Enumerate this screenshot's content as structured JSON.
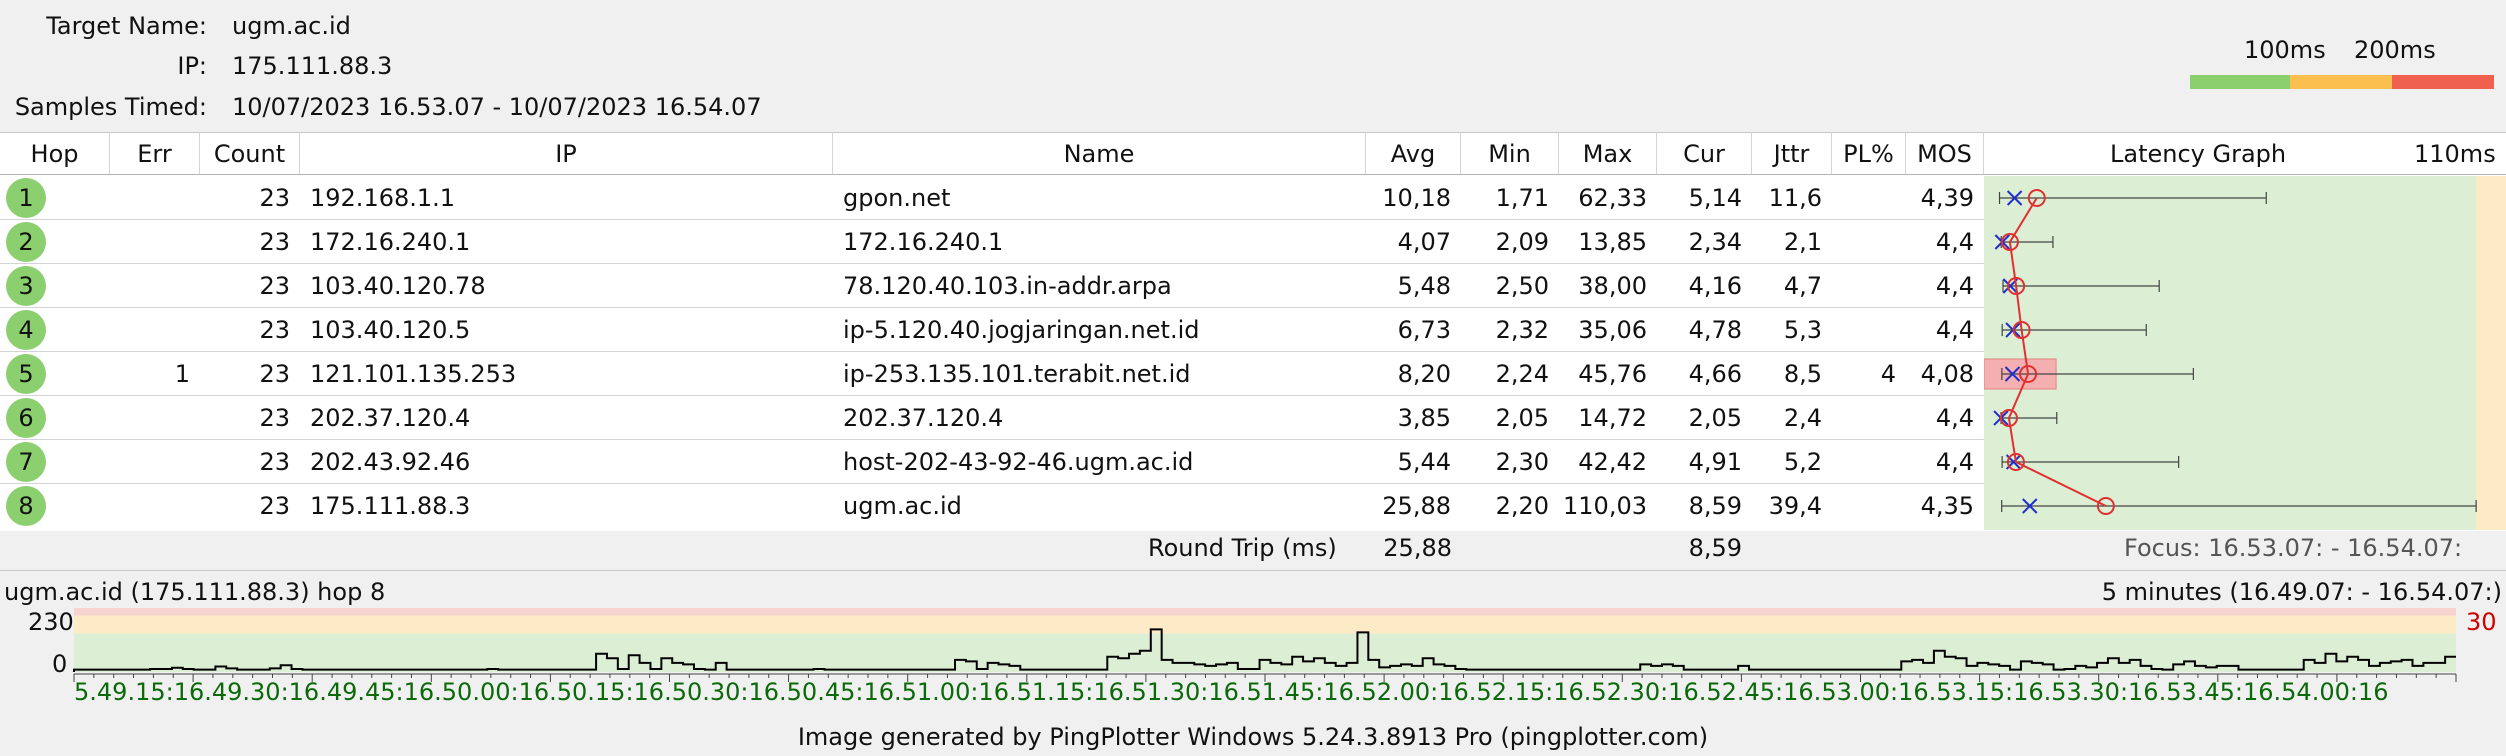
{
  "header": {
    "target_label": "Target Name:",
    "target_value": "ugm.ac.id",
    "ip_label": "IP:",
    "ip_value": "175.111.88.3",
    "samples_label": "Samples Timed:",
    "samples_value": "10/07/2023 16.53.07 - 10/07/2023 16.54.07"
  },
  "legend": {
    "label_100": "100ms",
    "label_200": "200ms",
    "colors": [
      "#8ccf6e",
      "#fbbf4f",
      "#f0604f"
    ]
  },
  "columns": {
    "hop": "Hop",
    "err": "Err",
    "count": "Count",
    "ip": "IP",
    "name": "Name",
    "avg": "Avg",
    "min": "Min",
    "max": "Max",
    "cur": "Cur",
    "jttr": "Jttr",
    "pl": "PL%",
    "mos": "MOS",
    "graph": "Latency Graph",
    "scale": "110ms"
  },
  "rows": [
    {
      "hop": "1",
      "err": "",
      "count": "23",
      "ip": "192.168.1.1",
      "name": "gpon.net",
      "avg": "10,18",
      "min": "1,71",
      "max": "62,33",
      "cur": "5,14",
      "jttr": "11,6",
      "pl": "",
      "mos": "4,39"
    },
    {
      "hop": "2",
      "err": "",
      "count": "23",
      "ip": "172.16.240.1",
      "name": "172.16.240.1",
      "avg": "4,07",
      "min": "2,09",
      "max": "13,85",
      "cur": "2,34",
      "jttr": "2,1",
      "pl": "",
      "mos": "4,4"
    },
    {
      "hop": "3",
      "err": "",
      "count": "23",
      "ip": "103.40.120.78",
      "name": "78.120.40.103.in-addr.arpa",
      "avg": "5,48",
      "min": "2,50",
      "max": "38,00",
      "cur": "4,16",
      "jttr": "4,7",
      "pl": "",
      "mos": "4,4"
    },
    {
      "hop": "4",
      "err": "",
      "count": "23",
      "ip": "103.40.120.5",
      "name": "ip-5.120.40.jogjaringan.net.id",
      "avg": "6,73",
      "min": "2,32",
      "max": "35,06",
      "cur": "4,78",
      "jttr": "5,3",
      "pl": "",
      "mos": "4,4"
    },
    {
      "hop": "5",
      "err": "1",
      "count": "23",
      "ip": "121.101.135.253",
      "name": "ip-253.135.101.terabit.net.id",
      "avg": "8,20",
      "min": "2,24",
      "max": "45,76",
      "cur": "4,66",
      "jttr": "8,5",
      "pl": "4",
      "mos": "4,08"
    },
    {
      "hop": "6",
      "err": "",
      "count": "23",
      "ip": "202.37.120.4",
      "name": "202.37.120.4",
      "avg": "3,85",
      "min": "2,05",
      "max": "14,72",
      "cur": "2,05",
      "jttr": "2,4",
      "pl": "",
      "mos": "4,4"
    },
    {
      "hop": "7",
      "err": "",
      "count": "23",
      "ip": "202.43.92.46",
      "name": "host-202-43-92-46.ugm.ac.id",
      "avg": "5,44",
      "min": "2,30",
      "max": "42,42",
      "cur": "4,91",
      "jttr": "5,2",
      "pl": "",
      "mos": "4,4"
    },
    {
      "hop": "8",
      "err": "",
      "count": "23",
      "ip": "175.111.88.3",
      "name": "ugm.ac.id",
      "avg": "25,88",
      "min": "2,20",
      "max": "110,03",
      "cur": "8,59",
      "jttr": "39,4",
      "pl": "",
      "mos": "4,35"
    }
  ],
  "graph": {
    "scale_max_ms": 110,
    "zone_colors": [
      "#dcefd4",
      "#fdebc8"
    ],
    "lost_row_color": "#f4b0b0"
  },
  "round_trip": {
    "label": "Round Trip (ms)",
    "avg": "25,88",
    "cur": "8,59",
    "focus": "Focus: 16.53.07: - 16.54.07:"
  },
  "timeline": {
    "target": "ugm.ac.id (175.111.88.3) hop 8",
    "range": "5 minutes (16.49.07: - 16.54.07:)",
    "y_top": "230",
    "y_zero": "0",
    "right_value": "30",
    "axis_labels": "5.49.15:16.49.30:16.49.45:16.50.00:16.50.15:16.50.30:16.50.45:16.51.00:16.51.15:16.51.30:16.51.45:16.52.00:16.52.15:16.52.30:16.52.45:16.53.00:16.53.15:16.53.30:16.53.45:16.54.00:16",
    "samples": [
      8,
      8,
      8,
      8,
      8,
      8,
      8,
      10,
      10,
      14,
      10,
      8,
      8,
      18,
      12,
      8,
      8,
      8,
      12,
      22,
      10,
      8,
      8,
      8,
      8,
      8,
      8,
      8,
      8,
      8,
      8,
      8,
      8,
      8,
      8,
      8,
      8,
      8,
      10,
      8,
      8,
      8,
      8,
      8,
      8,
      8,
      8,
      8,
      60,
      45,
      10,
      55,
      30,
      10,
      45,
      30,
      25,
      10,
      8,
      30,
      8,
      8,
      8,
      8,
      8,
      8,
      8,
      8,
      10,
      8,
      8,
      8,
      8,
      8,
      8,
      8,
      8,
      8,
      8,
      8,
      8,
      40,
      35,
      10,
      30,
      25,
      20,
      8,
      8,
      8,
      8,
      8,
      8,
      8,
      8,
      50,
      45,
      60,
      70,
      140,
      40,
      30,
      30,
      25,
      20,
      25,
      30,
      10,
      10,
      40,
      30,
      25,
      50,
      35,
      45,
      30,
      20,
      30,
      130,
      40,
      15,
      20,
      25,
      20,
      45,
      25,
      20,
      10,
      8,
      8,
      8,
      8,
      8,
      8,
      8,
      8,
      8,
      8,
      8,
      8,
      8,
      8,
      8,
      8,
      25,
      20,
      25,
      20,
      8,
      8,
      8,
      8,
      8,
      20,
      8,
      8,
      8,
      8,
      8,
      8,
      8,
      8,
      8,
      8,
      8,
      8,
      8,
      8,
      35,
      40,
      30,
      70,
      50,
      45,
      20,
      30,
      25,
      20,
      8,
      35,
      30,
      25,
      8,
      10,
      20,
      15,
      30,
      45,
      30,
      40,
      20,
      10,
      8,
      25,
      35,
      20,
      15,
      20,
      20,
      8,
      8,
      8,
      8,
      8,
      8,
      40,
      30,
      60,
      35,
      50,
      40,
      20,
      30,
      35,
      40,
      20,
      30,
      30,
      50
    ]
  },
  "footer": "Image generated by PingPlotter Windows 5.24.3.8913 Pro (pingplotter.com)"
}
